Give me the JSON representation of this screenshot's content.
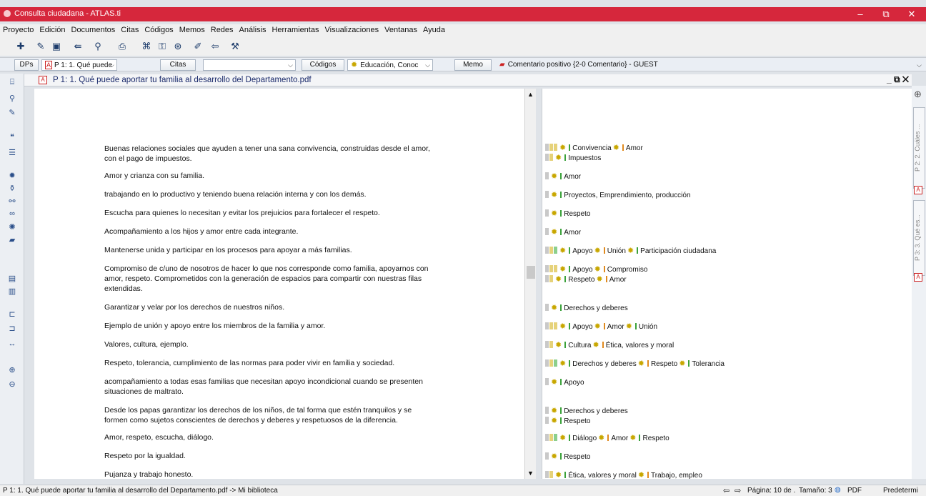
{
  "window": {
    "title": "Consulta ciudadana - ATLAS.ti",
    "minimize": "–",
    "restore": "⧉",
    "close": "✕"
  },
  "menu": [
    "Proyecto",
    "Edición",
    "Documentos",
    "Citas",
    "Códigos",
    "Memos",
    "Redes",
    "Análisis",
    "Herramientas",
    "Visualizaciones",
    "Ventanas",
    "Ayuda"
  ],
  "toolbar2": {
    "dps_label": "DPs",
    "doc_combo": "P 1: 1. Qué puede",
    "citas_label": "Citas",
    "citas_value": "",
    "codigos_label": "Códigos",
    "codigos_value": "Educación, Conoc",
    "memo_label": "Memo",
    "memo_value": "Comentario positivo {2-0 Comentario} - GUEST"
  },
  "document": {
    "title": "P 1: 1. Qué puede aportar tu familia al desarrollo del Departamento.pdf",
    "pdf_icon": "pdf-icon"
  },
  "lines": [
    "Buenas relaciones sociales que ayuden a tener una sana convivencia, construidas desde el amor,",
    "con el pago de impuestos.",
    "Amor y crianza con su familia.",
    "trabajando en lo productivo y teniendo buena relación interna y con los demás.",
    "Escucha para quienes lo necesitan y evitar los prejuicios para fortalecer el respeto.",
    "Acompañamiento a los hijos y amor entre cada integrante.",
    "Mantenerse unida y participar en los procesos para apoyar a más familias.",
    "Compromiso de c/uno de nosotros de hacer lo que nos corresponde como familia, apoyarnos con",
    "amor, respeto. Comprometidos con la generación de espacios para compartir con nuestras filas",
    "extendidas.",
    "Garantizar y velar por los derechos de nuestros niños.",
    "Ejemplo de unión y apoyo entre los miembros de la familia y amor.",
    "Valores, cultura, ejemplo.",
    "Respeto, tolerancia, cumplimiento de las normas para poder vivir en familia y sociedad.",
    "acompañamiento a todas esas familias que necesitan apoyo incondicional cuando se presenten",
    "situaciones de maltrato.",
    "Desde los papas garantizar los derechos de los niños, de tal forma que estén tranquilos y se",
    "formen como sujetos conscientes de derechos y deberes y respetuosos de la diferencia.",
    "Amor, respeto, escucha, diálogo.",
    "Respeto por la igualdad.",
    "Pujanza y trabajo honesto."
  ],
  "margin": [
    {
      "codes": [
        "Convivencia",
        "Amor"
      ]
    },
    {
      "codes": [
        "Impuestos"
      ]
    },
    {
      "codes": [
        "Amor"
      ]
    },
    {
      "codes": [
        "Proyectos, Emprendimiento, producción"
      ]
    },
    {
      "codes": [
        "Respeto"
      ]
    },
    {
      "codes": [
        "Amor"
      ]
    },
    {
      "codes": [
        "Apoyo",
        "Unión",
        "Participación ciudadana"
      ]
    },
    {
      "codes": [
        "Apoyo",
        "Compromiso"
      ]
    },
    {
      "codes": [
        "Respeto",
        "Amor"
      ]
    },
    {
      "codes": [
        "Derechos y deberes"
      ]
    },
    {
      "codes": [
        "Apoyo",
        "Amor",
        "Unión"
      ]
    },
    {
      "codes": [
        "Cultura",
        "Ética, valores y moral"
      ]
    },
    {
      "codes": [
        "Derechos y deberes",
        "Respeto",
        "Tolerancia"
      ]
    },
    {
      "codes": [
        "Apoyo"
      ]
    },
    {
      "codes": [
        "Derechos y deberes"
      ]
    },
    {
      "codes": [
        "Respeto"
      ]
    },
    {
      "codes": [
        "Diálogo",
        "Amor",
        "Respeto"
      ]
    },
    {
      "codes": [
        "Respeto"
      ]
    },
    {
      "codes": [
        "Ética, valores y moral",
        "Trabajo, empleo"
      ]
    }
  ],
  "side_tabs": [
    "P 2: 2. Cuáles ...",
    "P 3: 3. Qué es..."
  ],
  "status": {
    "left": "P 1: 1. Qué puede aportar tu familia al desarrollo del Departamento.pdf ->  Mi biblioteca",
    "page": "Página: 10 de .",
    "size": "Tamaño: 3",
    "pdf": "PDF",
    "right": "Predetermi"
  },
  "colors": {
    "title_bar": "#d6273c",
    "code_star": "#c8a700",
    "code_bar_green": "#3aa13a",
    "code_bar_orange": "#e08a1e",
    "sq_gray": "#c9c9c9",
    "sq_yellow": "#e6d27a",
    "sq_green": "#8ccf8c"
  }
}
